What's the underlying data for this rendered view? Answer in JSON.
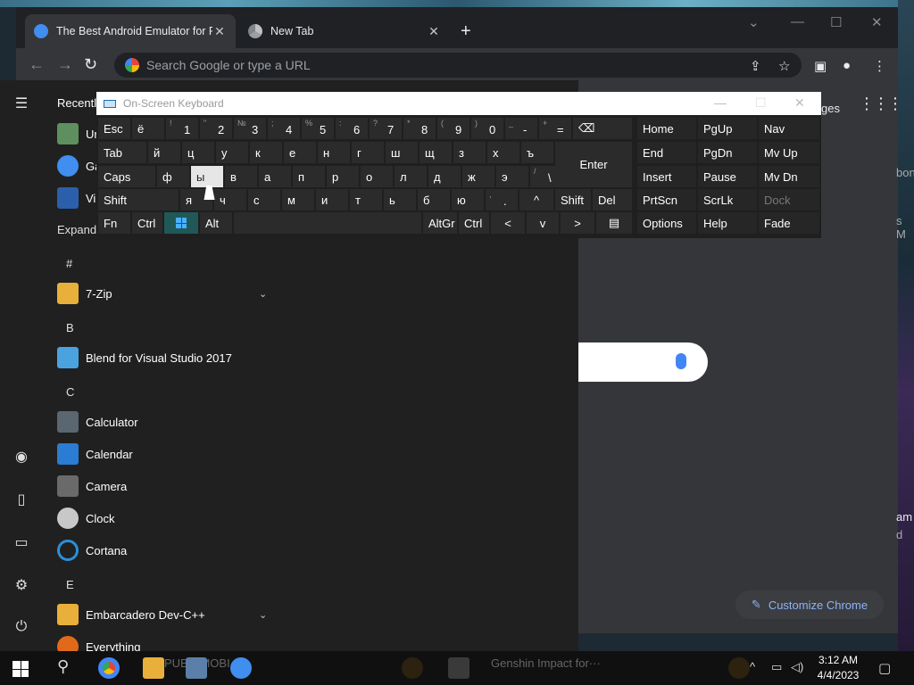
{
  "browser": {
    "tabs": [
      {
        "title": "The Best Android Emulator for P",
        "close": "✕",
        "favicon_color": "#3f8ef0"
      },
      {
        "title": "New Tab",
        "close": "✕",
        "favicon_color": "#9aa0a6"
      }
    ],
    "new_tab_symbol": "+",
    "window_controls": {
      "dropdown": "⌄",
      "minimize": "—",
      "maximize": "☐",
      "close": "✕"
    },
    "nav": {
      "back": "←",
      "forward": "→",
      "reload": "↻"
    },
    "omnibox_placeholder": "Search Google or type a URL",
    "toolbar_icons": {
      "share": "⇪",
      "star": "☆",
      "sidepanel": "▣",
      "profile": "●",
      "menu": "⋮"
    },
    "ntp": {
      "fragment_ges": "ges",
      "fragment_apps": "⋮⋮⋮",
      "fragment_bon": "bon",
      "fragment_s_m": "s M",
      "fragment_am": "am",
      "fragment_d": "d",
      "fragment_paren": ")",
      "customize_label": "Customize Chrome",
      "customize_icon": "✎"
    }
  },
  "start_menu": {
    "recently_label": "Recently",
    "recent_items": [
      {
        "label": "Ur",
        "icon_color": "#5f8f5f"
      },
      {
        "label": "Ga",
        "icon_color": "#3f8ef0"
      },
      {
        "label": "Vi",
        "icon_color": "#2b5fab"
      }
    ],
    "expand_label": "Expand",
    "sections": [
      {
        "header": "#",
        "apps": [
          {
            "name": "7-Zip",
            "icon_color": "#e8b03a",
            "has_chevron": true
          }
        ]
      },
      {
        "header": "B",
        "apps": [
          {
            "name": "Blend for Visual Studio 2017",
            "icon_color": "#4aa3df",
            "has_chevron": false
          }
        ]
      },
      {
        "header": "C",
        "apps": [
          {
            "name": "Calculator",
            "icon_color": "#5a6670",
            "has_chevron": false
          },
          {
            "name": "Calendar",
            "icon_color": "#2b7cd3",
            "has_chevron": false
          },
          {
            "name": "Camera",
            "icon_color": "#6a6a6a",
            "has_chevron": false
          },
          {
            "name": "Clock",
            "icon_color": "#c8c8c8",
            "has_chevron": false
          },
          {
            "name": "Cortana",
            "icon_color": "#2b8fd9",
            "has_chevron": false
          }
        ]
      },
      {
        "header": "E",
        "apps": [
          {
            "name": "Embarcadero Dev-C++",
            "icon_color": "#e8b03a",
            "has_chevron": true
          },
          {
            "name": "Everything",
            "icon_color": "#e06a1a",
            "has_chevron": false
          }
        ]
      }
    ],
    "rail_icons": {
      "menu": "☰",
      "user": "◉",
      "documents": "▯",
      "pictures": "▭",
      "settings": "⚙",
      "power": "⏻"
    },
    "chevron": "⌄"
  },
  "osk": {
    "title": "On-Screen Keyboard",
    "controls": {
      "minimize": "—",
      "maximize": "☐",
      "close": "✕"
    },
    "row1": [
      {
        "main": "Esc"
      },
      {
        "main": "ё"
      },
      {
        "shift": "!",
        "main": "1"
      },
      {
        "shift": "\"",
        "main": "2"
      },
      {
        "shift": "№",
        "main": "3"
      },
      {
        "shift": ";",
        "main": "4"
      },
      {
        "shift": "%",
        "main": "5"
      },
      {
        "shift": ":",
        "main": "6"
      },
      {
        "shift": "?",
        "main": "7"
      },
      {
        "shift": "*",
        "main": "8"
      },
      {
        "shift": "(",
        "main": "9"
      },
      {
        "shift": ")",
        "main": "0"
      },
      {
        "shift": "_",
        "main": "-"
      },
      {
        "shift": "+",
        "main": "="
      },
      {
        "main": "⌫"
      }
    ],
    "row2": [
      "Tab",
      "й",
      "ц",
      "у",
      "к",
      "е",
      "н",
      "г",
      "ш",
      "щ",
      "з",
      "х",
      "ъ",
      "Enter"
    ],
    "row3": [
      "Caps",
      "ф",
      "ы",
      "в",
      "а",
      "п",
      "р",
      "о",
      "л",
      "д",
      "ж",
      "э",
      "\\"
    ],
    "row3_backslash_shift": "/",
    "row4": [
      "Shift",
      "я",
      "ч",
      "с",
      "м",
      "и",
      "т",
      "ь",
      "б",
      "ю",
      ".",
      "^",
      "Shift",
      "Del"
    ],
    "row4_period_shift": ",",
    "row5": [
      "Fn",
      "Ctrl",
      "win",
      "Alt",
      "",
      "AltGr",
      "Ctrl",
      "<",
      "v",
      ">",
      "▤"
    ],
    "nav_col1": [
      "Home",
      "End",
      "Insert",
      "PrtScn",
      "Options"
    ],
    "nav_col2": [
      "PgUp",
      "PgDn",
      "Pause",
      "ScrLk",
      "Help"
    ],
    "nav_col3": [
      "Nav",
      "Mv Up",
      "Mv Dn",
      "Dock",
      "Fade"
    ],
    "highlighted_key": "ы"
  },
  "taskbar": {
    "search_icon": "⚲",
    "genshin_label": "Genshin Impact for···",
    "pubg_label": "PUBG MOBI",
    "time": "3:12 AM",
    "date": "4/4/2023",
    "tray": {
      "chevron": "^",
      "network": "▭",
      "volume": "◁)",
      "notifications": "▢"
    }
  }
}
